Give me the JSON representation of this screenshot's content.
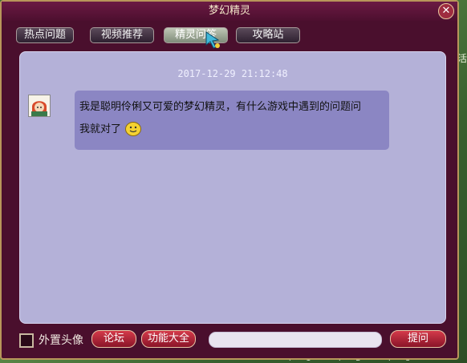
{
  "window": {
    "title": "梦幻精灵",
    "close": "✕"
  },
  "tabs": [
    {
      "label": "热点问题"
    },
    {
      "label": "视频推荐"
    },
    {
      "label": "精灵问答"
    },
    {
      "label": "攻略站"
    }
  ],
  "chat": {
    "timestamp": "2017-12-29 21:12:48",
    "message_line1": "我是聪明伶俐又可爱的梦幻精灵，有什么游戏中遇到的问题问",
    "message_line2": "我就对了"
  },
  "bottom": {
    "checkbox_label": "外置头像",
    "forum_label": "论坛",
    "features_label": "功能大全",
    "ask_label": "提问",
    "input_placeholder": ""
  },
  "background": {
    "side_text": "活",
    "strip_text": "P1 P2 P3 P4 P5 P6"
  }
}
